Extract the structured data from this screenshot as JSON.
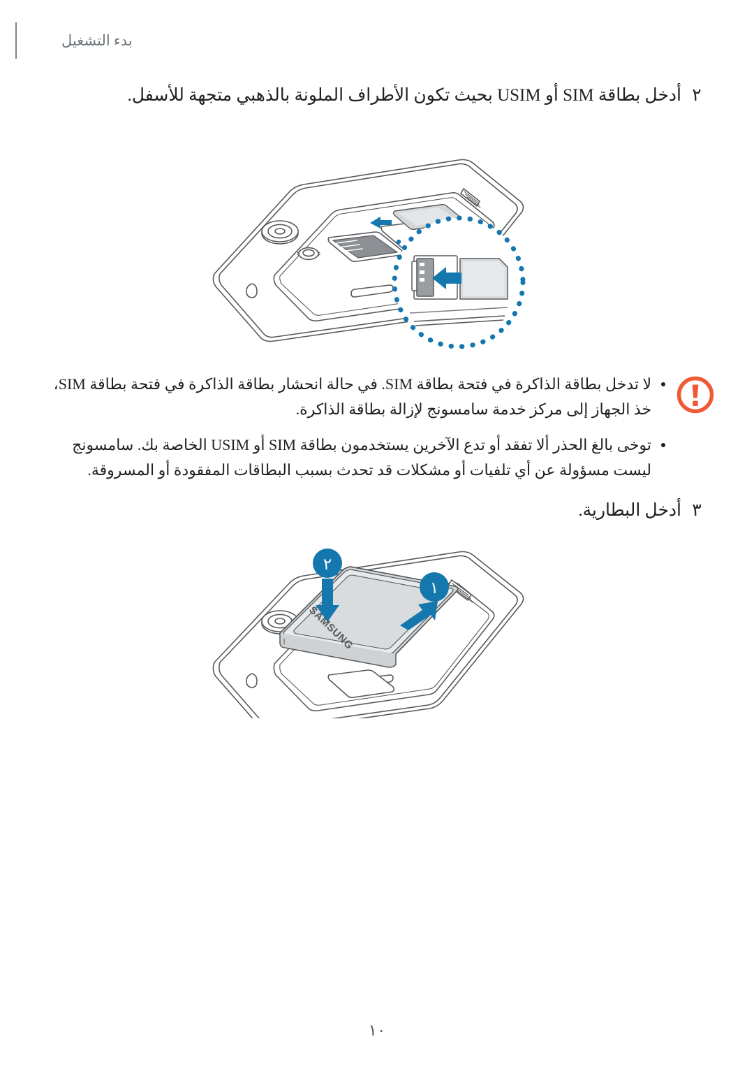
{
  "header": {
    "title": "بدء التشغيل"
  },
  "steps": [
    {
      "number": "٢",
      "text": "أدخل بطاقة SIM أو USIM بحيث تكون الأطراف الملونة بالذهبي متجهة للأسفل."
    },
    {
      "number": "٣",
      "text": "أدخل البطارية."
    }
  ],
  "note": {
    "icon": "warning-exclamation-icon",
    "icon_color": "#EF5A35",
    "bullets": [
      "لا تدخل بطاقة الذاكرة في فتحة بطاقة SIM. في حالة انحشار بطاقة الذاكرة في فتحة بطاقة SIM، خذ الجهاز إلى مركز خدمة سامسونج لإزالة بطاقة الذاكرة.",
      "توخى بالغ الحذر ألا تفقد أو تدع الآخرين يستخدمون بطاقة SIM أو USIM الخاصة بك. سامسونج ليست مسؤولة عن أي تلفيات أو مشكلات قد تحدث بسبب البطاقات المفقودة أو المسروقة."
    ]
  },
  "figures": {
    "sim_insert": {
      "name": "sim-card-insertion-illustration",
      "accent_color": "#1477AD",
      "line_color": "#58595B",
      "callout": {
        "style": "dotted-circle-magnifier",
        "arrow": "left-arrow-into-slot"
      }
    },
    "battery_insert": {
      "name": "battery-insertion-illustration",
      "accent_color": "#1477AD",
      "line_color": "#58595B",
      "battery_label": "SAMSUNG",
      "badges": [
        {
          "label": "١",
          "arrow": "arrow-up-right"
        },
        {
          "label": "٢",
          "arrow": "arrow-down"
        }
      ]
    }
  },
  "page_number": "١٠"
}
